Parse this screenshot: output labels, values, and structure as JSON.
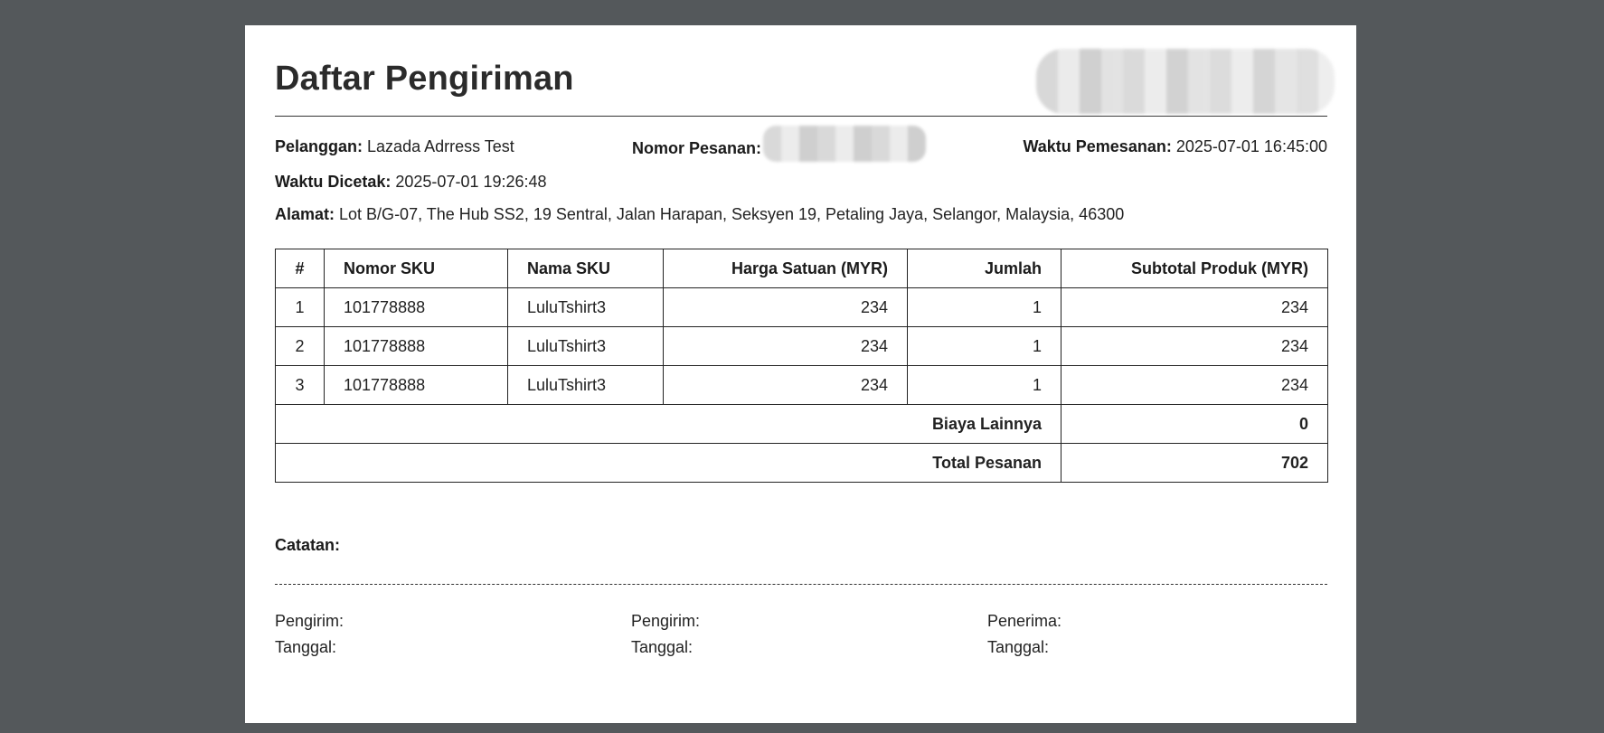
{
  "document": {
    "title": "Daftar Pengiriman"
  },
  "info": {
    "customer_label": "Pelanggan:",
    "customer_value": "Lazada Adrress Test",
    "order_no_label": "Nomor Pesanan:",
    "order_time_label": "Waktu Pemesanan:",
    "order_time_value": "2025-07-01 16:45:00",
    "print_time_label": "Waktu Dicetak:",
    "print_time_value": "2025-07-01 19:26:48",
    "address_label": "Alamat:",
    "address_value": "Lot B/G-07, The Hub SS2, 19 Sentral, Jalan Harapan, Seksyen 19, Petaling Jaya, Selangor, Malaysia, 46300"
  },
  "table": {
    "headers": [
      "#",
      "Nomor SKU",
      "Nama SKU",
      "Harga Satuan (MYR)",
      "Jumlah",
      "Subtotal Produk (MYR)"
    ],
    "rows": [
      [
        "1",
        "101778888",
        "LuluTshirt3",
        "234",
        "1",
        "234"
      ],
      [
        "2",
        "101778888",
        "LuluTshirt3",
        "234",
        "1",
        "234"
      ],
      [
        "3",
        "101778888",
        "LuluTshirt3",
        "234",
        "1",
        "234"
      ]
    ],
    "other_fees_label": "Biaya Lainnya",
    "other_fees_value": "0",
    "total_label": "Total Pesanan",
    "total_value": "702"
  },
  "notes_label": "Catatan:",
  "signatures": [
    {
      "role": "Pengirim:",
      "date": "Tanggal:"
    },
    {
      "role": "Pengirim:",
      "date": "Tanggal:"
    },
    {
      "role": "Penerima:",
      "date": "Tanggal:"
    }
  ]
}
